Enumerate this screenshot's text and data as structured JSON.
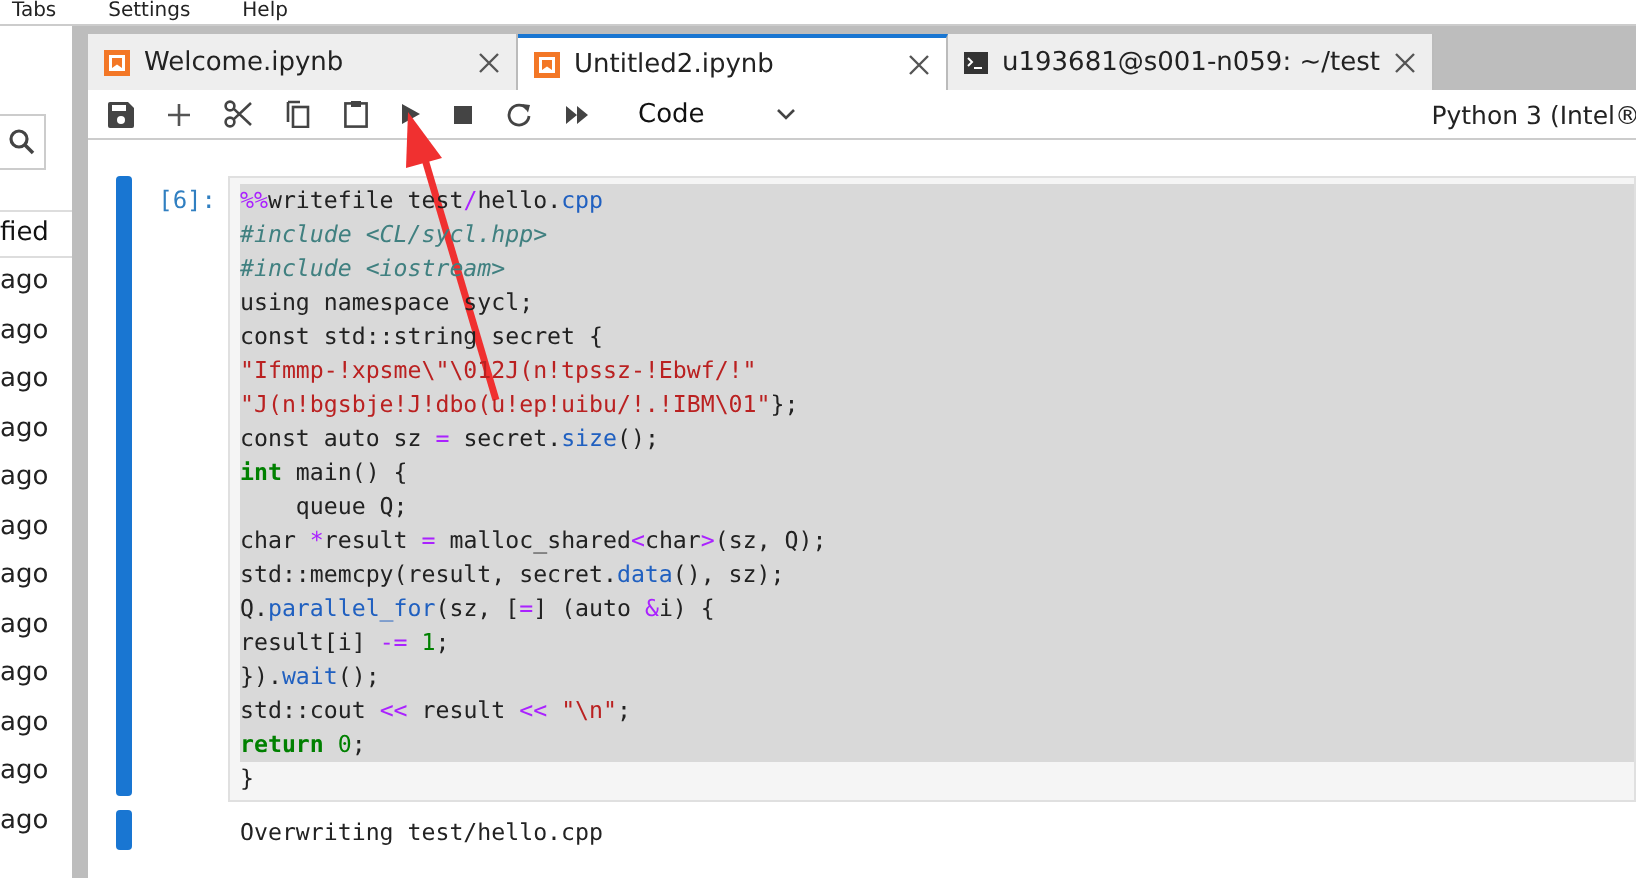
{
  "menu": [
    "Tabs",
    "Settings",
    "Help"
  ],
  "sidebar": {
    "column_header": "fied",
    "rows": [
      "ago",
      "ago",
      "ago",
      "ago",
      "ago",
      "ago",
      "ago",
      "ago",
      "ago",
      "ago",
      "ago",
      "ago"
    ]
  },
  "tabs": [
    {
      "label": "Welcome.ipynb",
      "kind": "notebook",
      "selected": false
    },
    {
      "label": "Untitled2.ipynb",
      "kind": "notebook",
      "selected": true
    },
    {
      "label": "u193681@s001-n059: ~/test",
      "kind": "terminal",
      "selected": false
    }
  ],
  "toolbar": {
    "cell_type": "Code",
    "kernel": "Python 3 (Intel®"
  },
  "cell": {
    "prompt": "[6]:",
    "lines": [
      [
        {
          "text": "%%",
          "kind": "op"
        },
        {
          "text": "writefile test",
          "kind": "plain"
        },
        {
          "text": "/",
          "kind": "op"
        },
        {
          "text": "hello.",
          "kind": "plain"
        },
        {
          "text": "cpp",
          "kind": "prop"
        }
      ],
      [
        {
          "text": "#include <CL/sycl.hpp>",
          "kind": "comment"
        }
      ],
      [
        {
          "text": "#include <iostream>",
          "kind": "comment"
        }
      ],
      [
        {
          "text": "using namespace sycl;",
          "kind": "plain"
        }
      ],
      [
        {
          "text": "const std::string secret {",
          "kind": "plain"
        }
      ],
      [
        {
          "text": "\"Ifmmp-!xpsme\\\"\\012J(n!tpssz-!Ebwf/!\"",
          "kind": "string"
        }
      ],
      [
        {
          "text": "\"J(n!bgsbje!J!dbo(u!ep!uibu/!.!IBM\\01\"",
          "kind": "string"
        },
        {
          "text": "};",
          "kind": "plain"
        }
      ],
      [
        {
          "text": "const auto sz ",
          "kind": "plain"
        },
        {
          "text": "=",
          "kind": "op"
        },
        {
          "text": " secret.",
          "kind": "plain"
        },
        {
          "text": "size",
          "kind": "prop"
        },
        {
          "text": "();",
          "kind": "plain"
        }
      ],
      [
        {
          "text": "int",
          "kind": "keyword"
        },
        {
          "text": " main() {",
          "kind": "plain"
        }
      ],
      [
        {
          "text": "    queue Q;",
          "kind": "plain"
        }
      ],
      [
        {
          "text": "char ",
          "kind": "plain"
        },
        {
          "text": "*",
          "kind": "op"
        },
        {
          "text": "result ",
          "kind": "plain"
        },
        {
          "text": "=",
          "kind": "op"
        },
        {
          "text": " malloc_shared",
          "kind": "plain"
        },
        {
          "text": "<",
          "kind": "op"
        },
        {
          "text": "char",
          "kind": "plain"
        },
        {
          "text": ">",
          "kind": "op"
        },
        {
          "text": "(sz, Q);",
          "kind": "plain"
        }
      ],
      [
        {
          "text": "std::memcpy(result, secret.",
          "kind": "plain"
        },
        {
          "text": "data",
          "kind": "prop"
        },
        {
          "text": "(), sz);",
          "kind": "plain"
        }
      ],
      [
        {
          "text": "Q.",
          "kind": "plain"
        },
        {
          "text": "parallel_for",
          "kind": "prop"
        },
        {
          "text": "(sz, [",
          "kind": "plain"
        },
        {
          "text": "=",
          "kind": "op"
        },
        {
          "text": "] (auto ",
          "kind": "plain"
        },
        {
          "text": "&",
          "kind": "op"
        },
        {
          "text": "i) {",
          "kind": "plain"
        }
      ],
      [
        {
          "text": "result[i] ",
          "kind": "plain"
        },
        {
          "text": "-=",
          "kind": "op"
        },
        {
          "text": " 1",
          "kind": "number"
        },
        {
          "text": ";",
          "kind": "plain"
        }
      ],
      [
        {
          "text": "}).",
          "kind": "plain"
        },
        {
          "text": "wait",
          "kind": "prop"
        },
        {
          "text": "();",
          "kind": "plain"
        }
      ],
      [
        {
          "text": "std::cout ",
          "kind": "plain"
        },
        {
          "text": "<<",
          "kind": "op"
        },
        {
          "text": " result ",
          "kind": "plain"
        },
        {
          "text": "<<",
          "kind": "op"
        },
        {
          "text": " \"\\n\"",
          "kind": "string"
        },
        {
          "text": ";",
          "kind": "plain"
        }
      ],
      [
        {
          "text": "return ",
          "kind": "keyword"
        },
        {
          "text": "0",
          "kind": "number"
        },
        {
          "text": ";",
          "kind": "plain"
        }
      ],
      [
        {
          "text": "}",
          "kind": "plain"
        }
      ]
    ],
    "output": "Overwriting test/hello.cpp"
  }
}
